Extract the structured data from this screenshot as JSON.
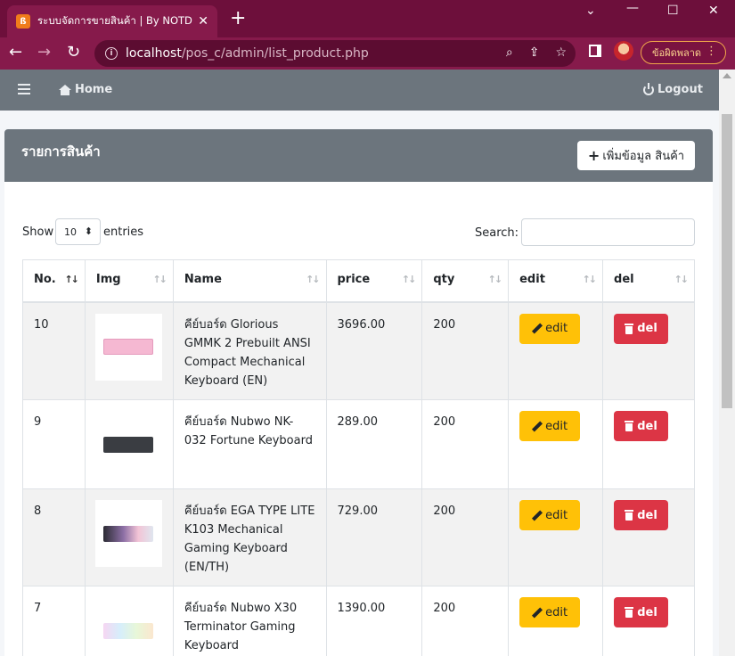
{
  "browser": {
    "tab_title": "ระบบจัดการขายสินค้า | By NOTDEV",
    "favicon_letter": "ß",
    "url_host": "localhost",
    "url_path": "/pos_c/admin/list_product.php",
    "error_label": "ข้อผิดพลาด"
  },
  "navbar": {
    "home_label": "Home",
    "logout_label": "Logout"
  },
  "card": {
    "title": "รายการสินค้า",
    "add_button_label": "เพิ่มข้อมูล สินค้า"
  },
  "table_controls": {
    "show_label": "Show",
    "page_size": "10",
    "entries_label": "entries",
    "search_label": "Search:"
  },
  "table": {
    "columns": [
      "No.",
      "Img",
      "Name",
      "price",
      "qty",
      "edit",
      "del"
    ],
    "edit_label": "edit",
    "del_label": "del",
    "rows": [
      {
        "no": "10",
        "name": "คีย์บอร์ด Glorious GMMK 2 Prebuilt ANSI Compact Mechanical Keyboard (EN)",
        "price": "3696.00",
        "qty": "200",
        "img_color": "#f5b8d2"
      },
      {
        "no": "9",
        "name": "คีย์บอร์ด Nubwo NK-032 Fortune Keyboard",
        "price": "289.00",
        "qty": "200",
        "img_color": "#3a3d42"
      },
      {
        "no": "8",
        "name": "คีย์บอร์ด EGA TYPE LITE K103 Mechanical Gaming Keyboard (EN/TH)",
        "price": "729.00",
        "qty": "200",
        "img_color": "#6b4f78"
      },
      {
        "no": "7",
        "name": "คีย์บอร์ด Nubwo X30 Terminator Gaming Keyboard",
        "price": "1390.00",
        "qty": "200",
        "img_color": "#e8eef4"
      }
    ]
  },
  "colors": {
    "browser_frame": "#6d0f3b",
    "navbar": "#6c757d",
    "edit_button": "#ffc107",
    "del_button": "#dc3545"
  }
}
